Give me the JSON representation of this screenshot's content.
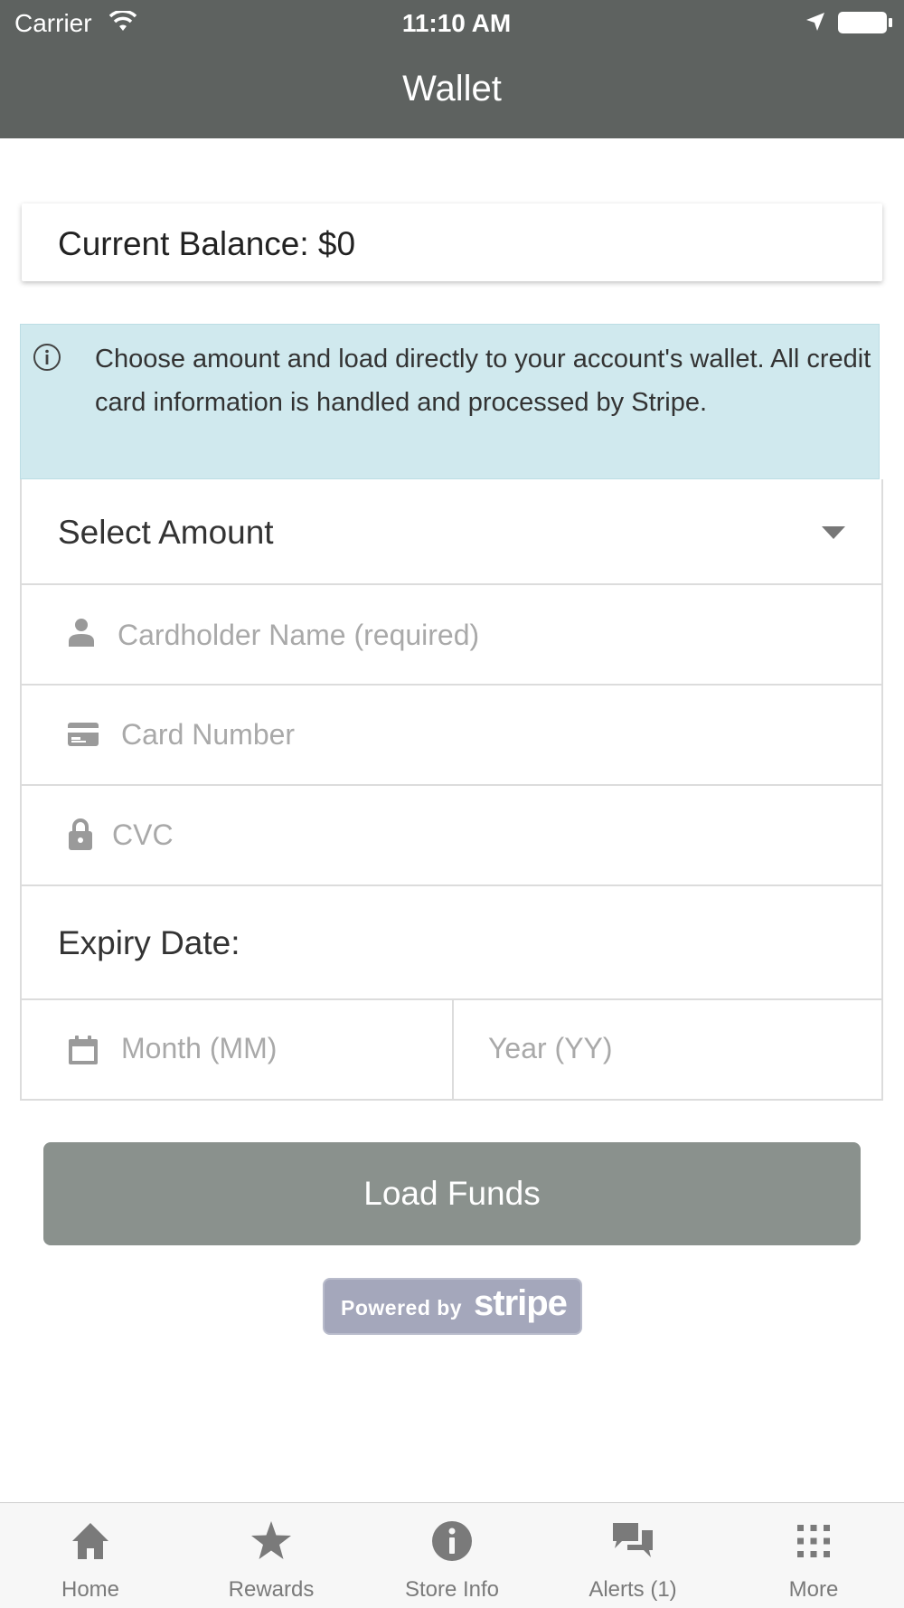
{
  "status_bar": {
    "carrier": "Carrier",
    "time": "11:10 AM"
  },
  "nav": {
    "title": "Wallet"
  },
  "balance": {
    "text": "Current Balance: $0"
  },
  "info": {
    "text": "Choose amount and load directly to your account's wallet. All credit card information is handled and processed by Stripe."
  },
  "form": {
    "select_amount": "Select Amount",
    "cardholder_placeholder": "Cardholder Name (required)",
    "card_number_placeholder": "Card Number",
    "cvc_placeholder": "CVC",
    "expiry_label": "Expiry Date:",
    "month_placeholder": "Month (MM)",
    "year_placeholder": "Year (YY)"
  },
  "load_button": {
    "label": "Load Funds"
  },
  "stripe_badge": {
    "powered": "Powered by",
    "logo": "stripe"
  },
  "tabs": [
    {
      "label": "Home",
      "icon": "home-icon"
    },
    {
      "label": "Rewards",
      "icon": "star-icon"
    },
    {
      "label": "Store Info",
      "icon": "info-icon"
    },
    {
      "label": "Alerts (1)",
      "icon": "chat-bubbles-icon"
    },
    {
      "label": "More",
      "icon": "grid-icon"
    }
  ],
  "colors": {
    "header": "#5e6260",
    "info_background": "#d0e9ee",
    "button": "#8a918d",
    "stripe_badge": "#a4a7bb",
    "tab_icon": "#7a7a7a"
  }
}
